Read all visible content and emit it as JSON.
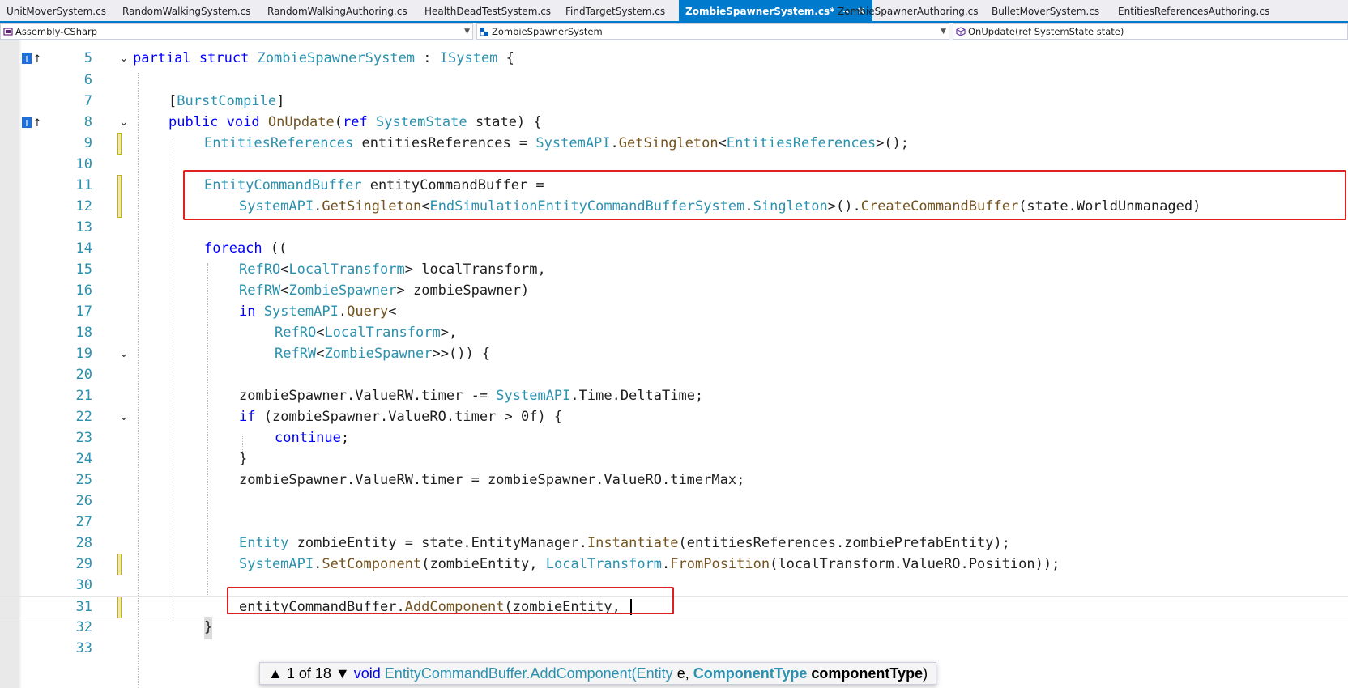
{
  "tabs": [
    {
      "label": "UnitMoverSystem.cs",
      "active": false
    },
    {
      "label": "RandomWalkingSystem.cs",
      "active": false
    },
    {
      "label": "RandomWalkingAuthoring.cs",
      "active": false
    },
    {
      "label": "HealthDeadTestSystem.cs",
      "active": false
    },
    {
      "label": "FindTargetSystem.cs",
      "active": false
    },
    {
      "label": "ZombieSpawnerSystem.cs*",
      "active": true
    },
    {
      "label": "ZombieSpawnerAuthoring.cs",
      "active": false
    },
    {
      "label": "BulletMoverSystem.cs",
      "active": false
    },
    {
      "label": "EntitiesReferencesAuthoring.cs",
      "active": false
    }
  ],
  "tab_glyphs": {
    "pin": "⊸",
    "close": "✕"
  },
  "navbar": {
    "project": "Assembly-CSharp",
    "type": "ZombieSpawnerSystem",
    "member": "OnUpdate(ref SystemState state)"
  },
  "editor": {
    "first_partial_line": "4",
    "lines": [
      {
        "n": "5",
        "text": "partial struct ZombieSpawnerSystem : ISystem {"
      },
      {
        "n": "6",
        "text": ""
      },
      {
        "n": "7",
        "text": "    [BurstCompile]"
      },
      {
        "n": "8",
        "text": "    public void OnUpdate(ref SystemState state) {"
      },
      {
        "n": "9",
        "text": "        EntitiesReferences entitiesReferences = SystemAPI.GetSingleton<EntitiesReferences>();"
      },
      {
        "n": "10",
        "text": ""
      },
      {
        "n": "11",
        "text": "        EntityCommandBuffer entityCommandBuffer ="
      },
      {
        "n": "12",
        "text": "            SystemAPI.GetSingleton<EndSimulationEntityCommandBufferSystem.Singleton>().CreateCommandBuffer(state.WorldUnmanaged)"
      },
      {
        "n": "13",
        "text": ""
      },
      {
        "n": "14",
        "text": "        foreach (("
      },
      {
        "n": "15",
        "text": "            RefRO<LocalTransform> localTransform,"
      },
      {
        "n": "16",
        "text": "            RefRW<ZombieSpawner> zombieSpawner)"
      },
      {
        "n": "17",
        "text": "            in SystemAPI.Query<"
      },
      {
        "n": "18",
        "text": "                RefRO<LocalTransform>,"
      },
      {
        "n": "19",
        "text": "                RefRW<ZombieSpawner>>()) {"
      },
      {
        "n": "20",
        "text": ""
      },
      {
        "n": "21",
        "text": "            zombieSpawner.ValueRW.timer -= SystemAPI.Time.DeltaTime;"
      },
      {
        "n": "22",
        "text": "            if (zombieSpawner.ValueRO.timer > 0f) {"
      },
      {
        "n": "23",
        "text": "                continue;"
      },
      {
        "n": "24",
        "text": "            }"
      },
      {
        "n": "25",
        "text": "            zombieSpawner.ValueRW.timer = zombieSpawner.ValueRO.timerMax;"
      },
      {
        "n": "26",
        "text": ""
      },
      {
        "n": "27",
        "text": ""
      },
      {
        "n": "28",
        "text": "            Entity zombieEntity = state.EntityManager.Instantiate(entitiesReferences.zombiePrefabEntity);"
      },
      {
        "n": "29",
        "text": "            SystemAPI.SetComponent(zombieEntity, LocalTransform.FromPosition(localTransform.ValueRO.Position));"
      },
      {
        "n": "30",
        "text": ""
      },
      {
        "n": "31",
        "text": "            entityCommandBuffer.AddComponent(zombieEntity, "
      },
      {
        "n": "32",
        "text": "        }"
      },
      {
        "n": "33",
        "text": ""
      }
    ]
  },
  "param_info": {
    "up_arrow": "▲",
    "counter": "1 of 18",
    "down_arrow": "▼",
    "return_type": "void",
    "method": "EntityCommandBuffer.AddComponent(",
    "param1_type": "Entity",
    "param1_name": "e,",
    "param2_type": "ComponentType",
    "param2_name": "componentType",
    "close_paren": ")"
  },
  "glyphs": {
    "fold_open": "⌄",
    "codelens": "I↑"
  },
  "colors": {
    "accent": "#007acc",
    "highlight_box": "#e02020",
    "keyword": "#0000ff",
    "type": "#2b91af",
    "method": "#74531f",
    "line_number": "#2b91af"
  }
}
